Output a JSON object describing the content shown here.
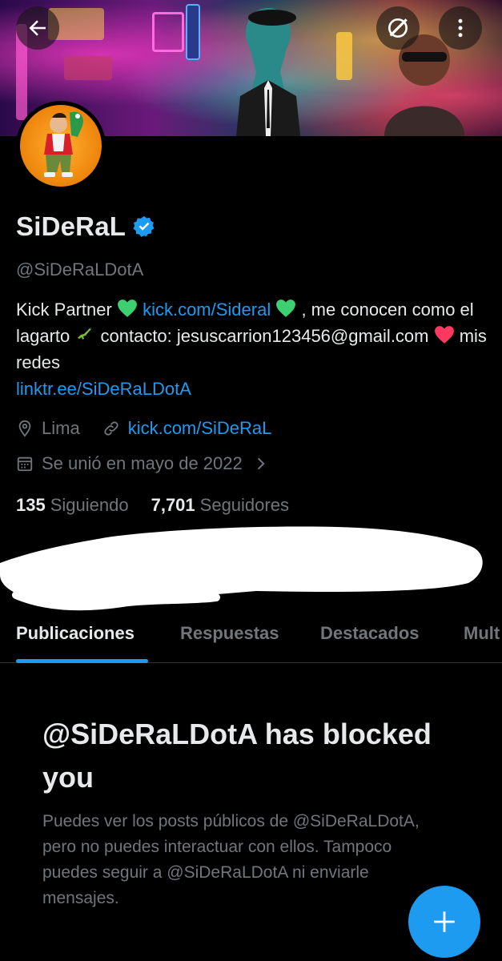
{
  "header": {
    "back_icon": "arrow-left-icon",
    "grok_icon": "slashed-circle-icon",
    "more_icon": "more-vertical-icon"
  },
  "profile": {
    "display_name": "SiDeRaL",
    "verified": true,
    "handle": "@SiDeRaLDotA",
    "bio": {
      "part1": "Kick Partner ",
      "link1": "kick.com/Sideral",
      "part2": " , me conocen como el lagarto ",
      "part3": " contacto: jesuscarrion123456@gmail.com ",
      "part4": " mis redes ",
      "link2": "linktr.ee/SiDeRaLDotA"
    },
    "location": "Lima",
    "website": "kick.com/SiDeRaL",
    "joined": "Se unió en mayo de 2022",
    "following_count": "135",
    "following_label": "Siguiendo",
    "followers_count": "7,701",
    "followers_label": "Seguidores"
  },
  "tabs": [
    {
      "label": "Publicaciones",
      "active": true
    },
    {
      "label": "Respuestas",
      "active": false
    },
    {
      "label": "Destacados",
      "active": false
    },
    {
      "label": "Mult",
      "active": false
    }
  ],
  "blocked": {
    "title": "@SiDeRaLDotA has blocked you",
    "body": "Puedes ver los posts públicos de @SiDeRaLDotA, pero no puedes interactuar con ellos. Tampoco puedes seguir a @SiDeRaLDotA ni enviarle mensajes."
  },
  "fab_icon": "plus-icon",
  "colors": {
    "accent": "#1d9bf0",
    "background": "#000000",
    "text": "#e7e9ea",
    "muted": "#71767b"
  }
}
